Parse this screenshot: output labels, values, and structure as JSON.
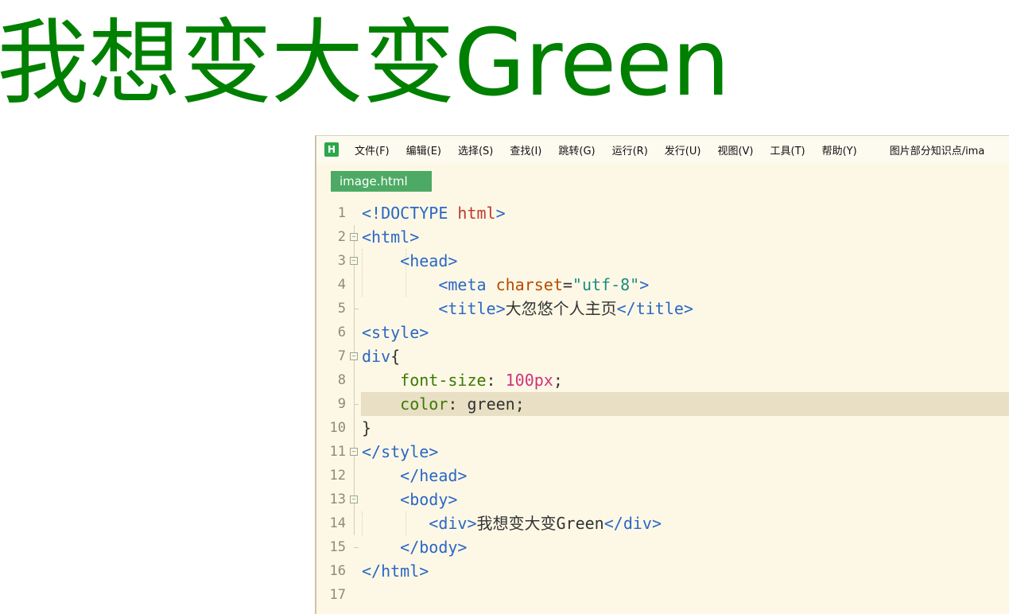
{
  "page": {
    "heading": "我想变大变Green",
    "heading_color": "#008000"
  },
  "editor": {
    "app_icon_letter": "H",
    "menu": [
      "文件(F)",
      "编辑(E)",
      "选择(S)",
      "查找(I)",
      "跳转(G)",
      "运行(R)",
      "发行(U)",
      "视图(V)",
      "工具(T)",
      "帮助(Y)"
    ],
    "window_title": "图片部分知识点/ima",
    "tab_label": "image.html",
    "accent_color": "#4daa64",
    "active_line": 9,
    "line_numbers": [
      "1",
      "2",
      "3",
      "4",
      "5",
      "6",
      "7",
      "8",
      "9",
      "10",
      "11",
      "12",
      "13",
      "14",
      "15",
      "16",
      "17"
    ],
    "code": {
      "l1_open": "<!DOCTYPE ",
      "l1_kw": "html",
      "l1_close": ">",
      "l2": "<html>",
      "l3": "<head>",
      "l4_open": "<meta ",
      "l4_attr": "charset",
      "l4_eq": "=",
      "l4_val": "\"utf-8\"",
      "l4_close": ">",
      "l5_open": "<title>",
      "l5_text": "大忽悠个人主页",
      "l5_close": "</title>",
      "l6": "<style>",
      "l7_sel": "div",
      "l7_brace": "{",
      "l8_prop": "font-size",
      "l8_colon": ": ",
      "l8_num": "100",
      "l8_unit": "px",
      "l8_semi": ";",
      "l9_prop": "color",
      "l9_colon": ": ",
      "l9_val": "green",
      "l9_semi": ";",
      "l10": "}",
      "l11": "</style>",
      "l12": "</head>",
      "l13": "<body>",
      "l14_open": "<div>",
      "l14_text": "我想变大变Green",
      "l14_close": "</div>",
      "l15": "</body>",
      "l16": "</html>",
      "l17": ""
    }
  }
}
